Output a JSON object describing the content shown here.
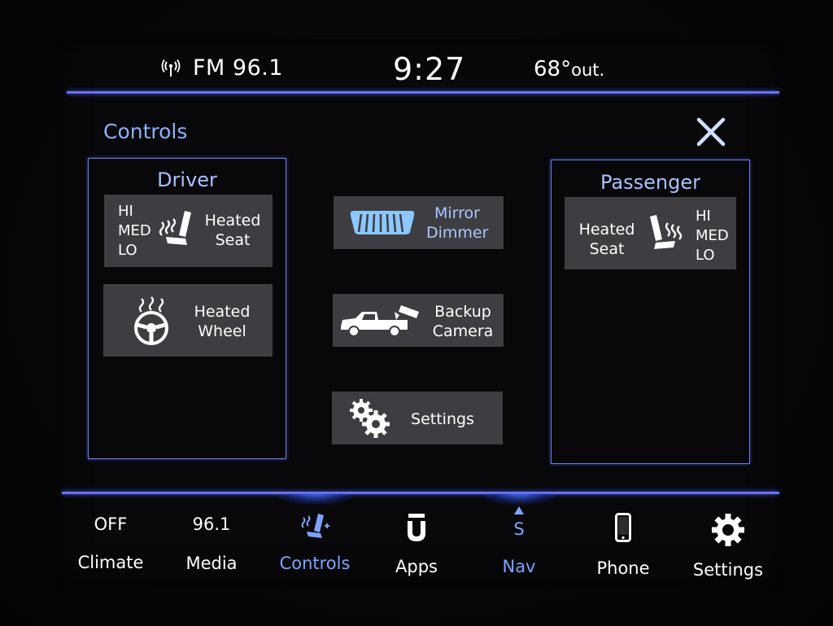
{
  "status": {
    "radio": "FM 96.1",
    "time": "9:27",
    "temp": "68°",
    "temp_suffix": "out."
  },
  "page": {
    "title": "Controls",
    "close_icon": "close-x-icon"
  },
  "driver": {
    "title": "Driver",
    "heated_seat": {
      "levels": [
        "HI",
        "MED",
        "LO"
      ],
      "label_line1": "Heated",
      "label_line2": "Seat",
      "icon": "heated-seat-icon"
    },
    "heated_wheel": {
      "label_line1": "Heated",
      "label_line2": "Wheel",
      "icon": "heated-steering-wheel-icon"
    }
  },
  "center": {
    "mirror": {
      "label_line1": "Mirror",
      "label_line2": "Dimmer",
      "icon": "rearview-mirror-icon"
    },
    "camera": {
      "label_line1": "Backup",
      "label_line2": "Camera",
      "icon": "truck-camera-icon"
    },
    "settings": {
      "label": "Settings",
      "icon": "gears-icon"
    }
  },
  "passenger": {
    "title": "Passenger",
    "heated_seat": {
      "levels": [
        "HI",
        "MED",
        "LO"
      ],
      "label_line1": "Heated",
      "label_line2": "Seat",
      "icon": "heated-seat-icon"
    }
  },
  "bottom_nav": [
    {
      "top": "OFF",
      "label": "Climate"
    },
    {
      "top": "96.1",
      "label": "Media"
    },
    {
      "label": "Controls",
      "icon": "controls-seat-icon",
      "active": true
    },
    {
      "label": "Apps",
      "icon": "apps-u-icon"
    },
    {
      "top": "S",
      "label": "Nav",
      "icon": "compass-arrow-icon",
      "active": true
    },
    {
      "label": "Phone",
      "icon": "phone-icon"
    },
    {
      "label": "Settings",
      "icon": "gear-icon"
    }
  ],
  "colors": {
    "accent_line": "#6a76e8",
    "active_text": "#7fa2ff",
    "tile_bg": "#3e3e42",
    "title_blue": "#8fb0ff"
  }
}
